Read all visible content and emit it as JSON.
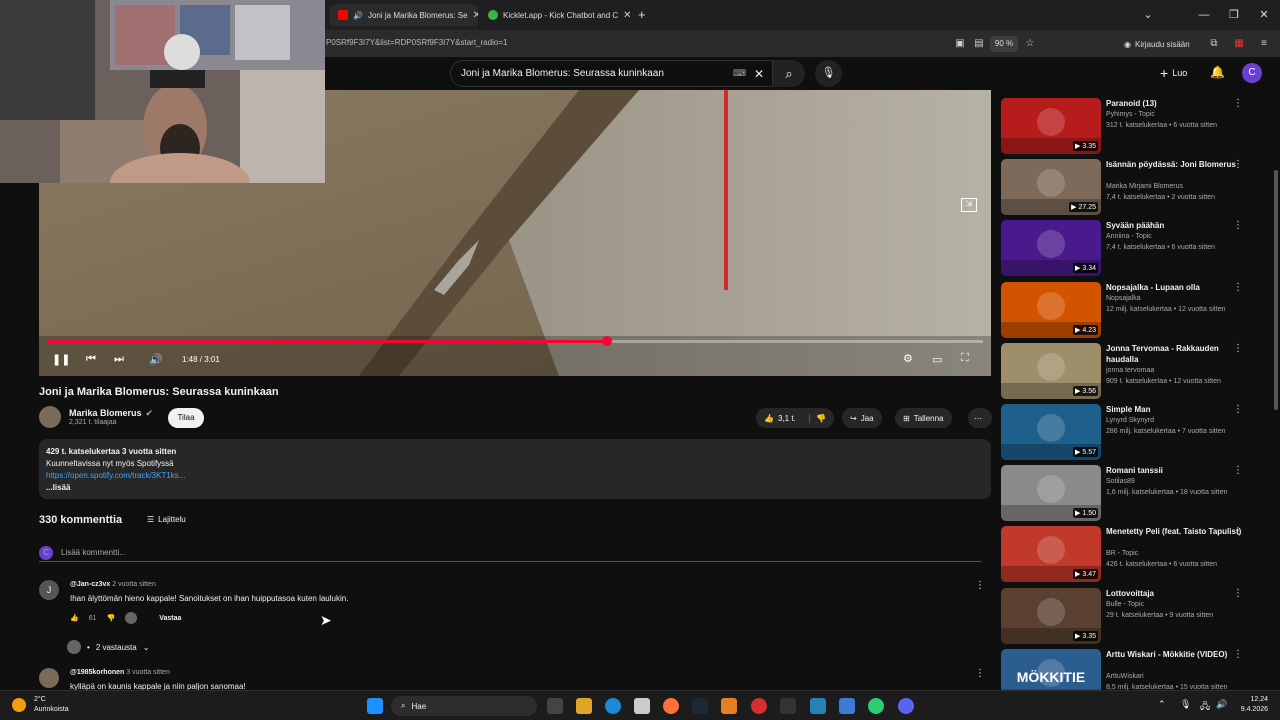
{
  "browser": {
    "tabs": [
      {
        "title": "Joni ja Marika Blomerus: Se",
        "active": true
      },
      {
        "title": "Kicklet.app - Kick Chatbot and C",
        "active": false
      }
    ],
    "new_tab": "+",
    "url": "P0SRf9F3I7Y&list=RDP0SRf9F3I7Y&start_radio=1",
    "zoom": "90 %",
    "signin": "Kirjaudu sisään"
  },
  "youtube": {
    "search_value": "Joni ja Marika Blomerus: Seurassa kuninkaan",
    "create_label": "Luo",
    "avatar_letter": "C"
  },
  "player": {
    "time": "1:48 / 3:01",
    "progress": 0.598
  },
  "video": {
    "title": "Joni ja Marika Blomerus: Seurassa kuninkaan",
    "channel": "Marika Blomerus",
    "subscribers": "2,321 t. tilaajaa",
    "subscribe_label": "Tilaa",
    "likes": "3,1 t.",
    "share_label": "Jaa",
    "save_label": "Tallenna"
  },
  "description": {
    "stats": "429 t. katselukertaa  3 vuotta sitten",
    "line1": "Kuunneltavissa nyt myös Spotifyssä",
    "link": "https://open.spotify.com/track/3KT1ks...",
    "more": "...lisää"
  },
  "comments": {
    "count": "330 kommenttia",
    "sort_label": "Lajittelu",
    "add_placeholder": "Lisää kommentti...",
    "user_letter": "C",
    "items": [
      {
        "avatar": "J",
        "author": "@Jan-cz3vx",
        "time": "2 vuotta sitten",
        "text": "Ihan älyttömän hieno kappale! Sanoitukset on ihan huipputasoa kuten laulukin.",
        "likes": "61",
        "reply_label": "Vastaa",
        "replies": "2 vastausta"
      },
      {
        "avatar": "",
        "author": "@1985korhonen",
        "time": "3 vuotta sitten",
        "text": "kylläpä on kaunis kappale ja niin paljon sanomaa!"
      }
    ]
  },
  "sidebar": [
    {
      "title": "Paranoid (13)",
      "channel": "Pyhimys - Topic",
      "meta": "312 t. katselukertaa • 6 vuotta sitten",
      "duration": "3.35",
      "color": "#b71c1c"
    },
    {
      "title": "Isännän pöydässä: Joni Blomerus",
      "channel": "Marika Mirjami Blomerus",
      "meta": "7,4 t. katselukertaa • 2 vuotta sitten",
      "duration": "27.25",
      "color": "#7d6a5a"
    },
    {
      "title": "Syvään päähän",
      "channel": "Anniina - Topic",
      "meta": "7,4 t. katselukertaa • 6 vuotta sitten",
      "duration": "3.34",
      "color": "#4a1a8c"
    },
    {
      "title": "Nopsajalka - Lupaan olla",
      "channel": "Nopsajalka",
      "meta": "12 milj. katselukertaa • 12 vuotta sitten",
      "duration": "4.23",
      "color": "#d35400"
    },
    {
      "title": "Jonna Tervomaa - Rakkauden haudalla",
      "channel": "jonna tervomaa",
      "meta": "909 t. katselukertaa • 12 vuotta sitten",
      "duration": "3.56",
      "color": "#9e8f6a"
    },
    {
      "title": "Simple Man",
      "channel": "Lynyrd Skynyrd",
      "meta": "286 milj. katselukertaa • 7 vuotta sitten",
      "duration": "5.57",
      "color": "#1f5f8b"
    },
    {
      "title": "Romani tanssii",
      "channel": "Sotilas89",
      "meta": "1,6 milj. katselukertaa • 18 vuotta sitten",
      "duration": "1.50",
      "color": "#8a8a8a"
    },
    {
      "title": "Menetetty Peli (feat. Taisto Tapulist)",
      "channel": "BR - Topic",
      "meta": "426 t. katselukertaa • 6 vuotta sitten",
      "duration": "3.47",
      "color": "#c0392b"
    },
    {
      "title": "Lottovoittaja",
      "channel": "Bulle - Topic",
      "meta": "29 t. katselukertaa • 9 vuotta sitten",
      "duration": "3.35",
      "color": "#5a4030"
    },
    {
      "title": "Arttu Wiskari - Mökkitie (VIDEO)",
      "channel": "ArttuWiskari",
      "meta": "8,5 milj. katselukertaa • 15 vuotta sitten",
      "duration": "",
      "thumb_text": "MÖKKITIE",
      "color": "#2c5d8f"
    }
  ],
  "taskbar": {
    "weather_temp": "2°C",
    "weather_text": "Aurinkoista",
    "search_label": "Hae",
    "time": "12.24",
    "date": "9.4.2026"
  }
}
